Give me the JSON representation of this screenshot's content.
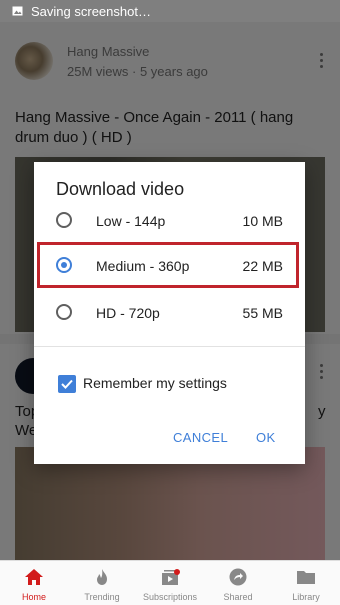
{
  "status_bar": {
    "text": "Saving screenshot…"
  },
  "feed": {
    "card1": {
      "channel": "Hang Massive",
      "meta": "25M views · 5 years ago",
      "title": "Hang Massive - Once Again - 2011 ( hang drum duo ) ( HD )"
    },
    "card2": {
      "title_line1": "Top",
      "title_line2": "We",
      "title_tail": "y"
    }
  },
  "dialog": {
    "title": "Download video",
    "options": [
      {
        "label": "Low - 144p",
        "size": "10 MB",
        "selected": false
      },
      {
        "label": "Medium - 360p",
        "size": "22 MB",
        "selected": true
      },
      {
        "label": "HD - 720p",
        "size": "55 MB",
        "selected": false
      }
    ],
    "remember": {
      "label": "Remember my settings",
      "checked": true
    },
    "cancel_label": "CANCEL",
    "ok_label": "OK"
  },
  "nav": {
    "items": [
      {
        "label": "Home",
        "active": true
      },
      {
        "label": "Trending",
        "active": false
      },
      {
        "label": "Subscriptions",
        "active": false
      },
      {
        "label": "Shared",
        "active": false
      },
      {
        "label": "Library",
        "active": false
      }
    ]
  },
  "colors": {
    "accent": "#3f7fd8",
    "highlight": "#c0242c",
    "brand": "#d21b1b"
  }
}
